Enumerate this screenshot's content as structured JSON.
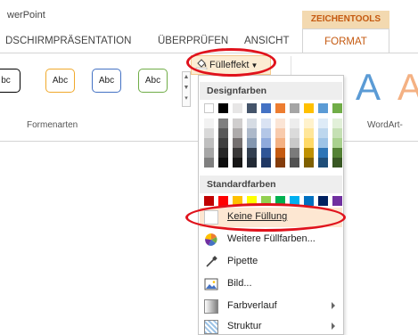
{
  "app": {
    "title": "werPoint"
  },
  "ribbon": {
    "contextual_group": "ZEICHENTOOLS",
    "tabs": [
      {
        "label": "DSCHIRMPRÄSENTATION"
      },
      {
        "label": "ÜBERPRÜFEN"
      },
      {
        "label": "ANSICHT"
      }
    ],
    "active_tab": "FORMAT",
    "shape_styles": [
      {
        "label": "bc",
        "border": "#000000"
      },
      {
        "label": "Abc",
        "border": "#f0a92c"
      },
      {
        "label": "Abc",
        "border": "#4472c4"
      },
      {
        "label": "Abc",
        "border": "#70ad47"
      }
    ],
    "group_formenarten": "Formenarten",
    "group_wordart": "WordArt-",
    "fill_button": "Fülleffekt",
    "wordart_letters": [
      "A",
      "A"
    ]
  },
  "dropdown": {
    "design_header": "Designfarben",
    "standard_header": "Standardfarben",
    "design_top_row": [
      "#ffffff",
      "#000000",
      "#e7e6e6",
      "#44546a",
      "#4472c4",
      "#ed7d31",
      "#a5a5a5",
      "#ffc000",
      "#5b9bd5",
      "#70ad47"
    ],
    "design_shades": [
      [
        "#f2f2f2",
        "#7f7f7f",
        "#d0cece",
        "#d6dce4",
        "#dae3f3",
        "#fbe5d6",
        "#ededed",
        "#fff2cc",
        "#deebf7",
        "#e2f0d9"
      ],
      [
        "#d9d9d9",
        "#595959",
        "#aeabab",
        "#adb9ca",
        "#b4c7e7",
        "#f8cbad",
        "#dbdbdb",
        "#ffe699",
        "#bdd7ee",
        "#c5e0b4"
      ],
      [
        "#bfbfbf",
        "#3f3f3f",
        "#757070",
        "#8497b0",
        "#8faadc",
        "#f4b183",
        "#c9c9c9",
        "#ffd966",
        "#9dc3e6",
        "#a9d18e"
      ],
      [
        "#a6a6a6",
        "#262626",
        "#3a3838",
        "#333f50",
        "#2f5597",
        "#c55a11",
        "#7b7b7b",
        "#bf9000",
        "#2e75b6",
        "#548235"
      ],
      [
        "#7f7f7f",
        "#0d0d0d",
        "#171616",
        "#222a35",
        "#203864",
        "#843c0c",
        "#525252",
        "#7f6000",
        "#1f4e79",
        "#385723"
      ]
    ],
    "standard_colors": [
      "#c00000",
      "#ff0000",
      "#ffc000",
      "#ffff00",
      "#92d050",
      "#00b050",
      "#00b0f0",
      "#0070c0",
      "#002060",
      "#7030a0"
    ],
    "items": [
      {
        "name": "keine-fuellung",
        "label": "Keine Füllung",
        "icon": "no-fill-icon"
      },
      {
        "name": "weitere-fuellfarben",
        "label": "Weitere Füllfarben...",
        "icon": "color-wheel-icon"
      },
      {
        "name": "pipette",
        "label": "Pipette",
        "icon": "eyedropper-icon"
      },
      {
        "name": "bild",
        "label": "Bild...",
        "icon": "picture-icon"
      },
      {
        "name": "farbverlauf",
        "label": "Farbverlauf",
        "icon": "gradient-icon"
      },
      {
        "name": "struktur",
        "label": "Struktur",
        "icon": "texture-icon"
      }
    ]
  }
}
